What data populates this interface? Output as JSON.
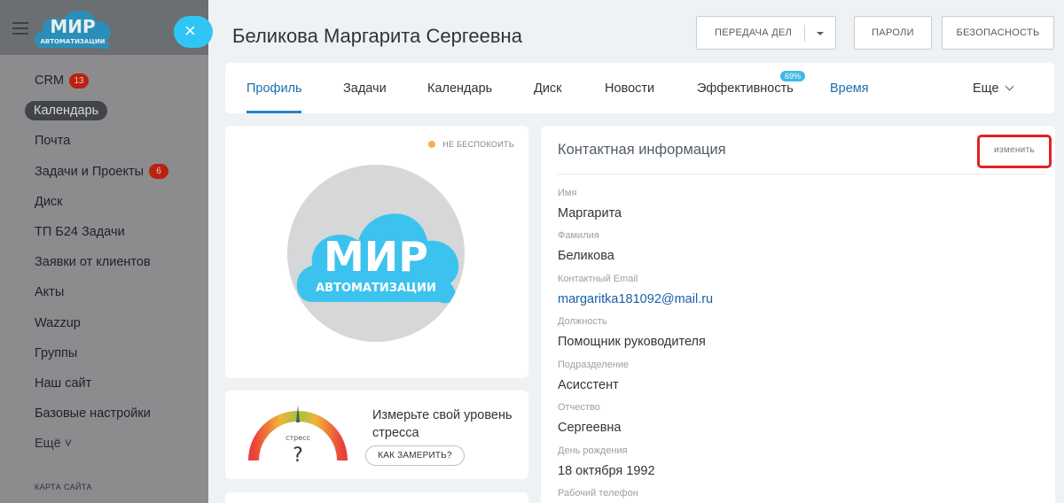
{
  "colors": {
    "accent": "#2a84c7",
    "link": "#1b5fa6",
    "badge_red": "#b9230e",
    "status_dot": "#efb44d",
    "highlight": "#e02222",
    "close_button": "#2fc6f6"
  },
  "sidebar": {
    "logo": {
      "line1": "МИР",
      "line2": "АВТОМАТИЗАЦИИ"
    },
    "items": [
      {
        "label": "CRM",
        "badge": "13"
      },
      {
        "label": "Календарь",
        "active": true
      },
      {
        "label": "Почта"
      },
      {
        "label": "Задачи и Проекты",
        "badge": "6"
      },
      {
        "label": "Диск"
      },
      {
        "label": "ТП Б24 Задачи"
      },
      {
        "label": "Заявки от клиентов"
      },
      {
        "label": "Акты"
      },
      {
        "label": "Wazzup"
      },
      {
        "label": "Группы"
      },
      {
        "label": "Наш сайт"
      },
      {
        "label": "Базовые настройки"
      },
      {
        "label": "Ещё ˅"
      }
    ],
    "sitemap_label": "КАРТА САЙТА"
  },
  "header": {
    "title": "Беликова Маргарита Сергеевна",
    "transfer_label": "ПЕРЕДАЧА ДЕЛ",
    "passwords_label": "ПАРОЛИ",
    "security_label": "БЕЗОПАСНОСТЬ"
  },
  "tabs": {
    "profile": "Профиль",
    "tasks": "Задачи",
    "calendar": "Календарь",
    "disk": "Диск",
    "news": "Новости",
    "efficiency": "Эффективность",
    "efficiency_badge": "69%",
    "time": "Время",
    "more": "Еще"
  },
  "profile": {
    "status": "НЕ БЕСПОКОИТЬ",
    "avatar_logo": {
      "line1": "МИР",
      "line2": "АВТОМАТИЗАЦИИ"
    }
  },
  "stress": {
    "title": "Измерьте свой уровень стресса",
    "gauge_label": "стресс",
    "gauge_value": "?",
    "button_label": "КАК ЗАМЕРИТЬ?"
  },
  "contact": {
    "title": "Контактная информация",
    "edit_label": "изменить",
    "fields": [
      {
        "label": "Имя",
        "value": "Маргарита"
      },
      {
        "label": "Фамилия",
        "value": "Беликова"
      },
      {
        "label": "Контактный Email",
        "value": "margaritka181092@mail.ru"
      },
      {
        "label": "Должность",
        "value": "Помощник руководителя"
      },
      {
        "label": "Подразделение",
        "value": "Асисстент"
      },
      {
        "label": "Отчество",
        "value": "Сергеевна"
      },
      {
        "label": "День рождения",
        "value": "18 октября 1992"
      },
      {
        "label": "Рабочий телефон",
        "value": ""
      }
    ]
  }
}
